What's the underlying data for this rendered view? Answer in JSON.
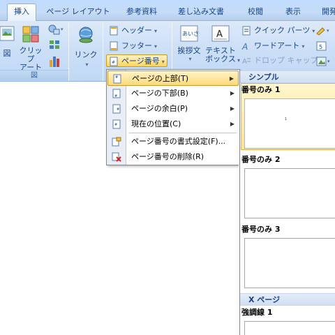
{
  "tabs": [
    {
      "label": "挿入",
      "active": true
    },
    {
      "label": "ページ レイアウト",
      "active": false
    },
    {
      "label": "参考資料",
      "active": false
    },
    {
      "label": "差し込み文書",
      "active": false
    },
    {
      "label": "校閲",
      "active": false
    },
    {
      "label": "表示",
      "active": false
    },
    {
      "label": "開発",
      "active": false
    }
  ],
  "ribbon": {
    "illustrations": {
      "picture_label": "図",
      "clipart_label": "クリップ\nアート",
      "group_label": "図"
    },
    "links": {
      "link_label": "リンク"
    },
    "header_footer": {
      "header_label": "ヘッダー",
      "footer_label": "フッター",
      "page_number_label": "ページ番号"
    },
    "text": {
      "greeting_label": "挨拶文",
      "textbox_label": "テキスト\nボックス",
      "quickparts_label": "クイック パーツ",
      "wordart_label": "ワードアート",
      "dropcap_label": "ドロップ キャップ"
    }
  },
  "menu": {
    "items": [
      {
        "label": "ページの上部(T)",
        "submenu": true,
        "highlighted": true
      },
      {
        "label": "ページの下部(B)",
        "submenu": true,
        "highlighted": false
      },
      {
        "label": "ページの余白(P)",
        "submenu": true,
        "highlighted": false
      },
      {
        "label": "現在の位置(C)",
        "submenu": true,
        "highlighted": false
      },
      {
        "label": "ページ番号の書式設定(F)...",
        "submenu": false,
        "highlighted": false
      },
      {
        "label": "ページ番号の削除(R)",
        "submenu": false,
        "highlighted": false
      }
    ]
  },
  "gallery": {
    "section_simple": "シンプル",
    "items": [
      {
        "label": "番号のみ 1",
        "selected": true,
        "page_marker": "1"
      },
      {
        "label": "番号のみ 2",
        "selected": false
      },
      {
        "label": "番号のみ 3",
        "selected": false
      }
    ],
    "section_xpage": "X ページ",
    "emphasis_label": "強調線 1"
  },
  "colors": {
    "ribbon_bg": "#cadef7",
    "accent_text": "#15428b",
    "hover_gold": "#ffd97a"
  }
}
